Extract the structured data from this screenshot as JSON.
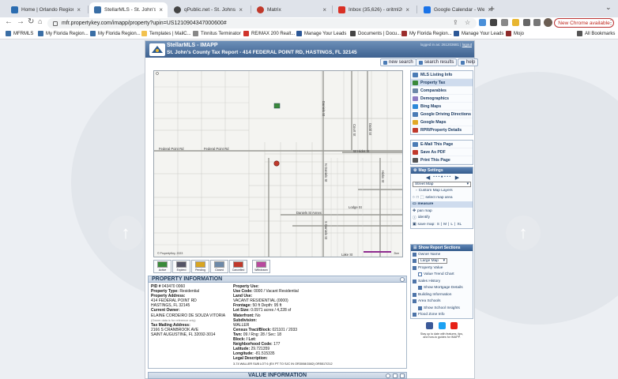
{
  "browser": {
    "tabs": [
      {
        "title": "Home | Orlando Regional REALTOR",
        "color": "#2b6cb0",
        "active": false
      },
      {
        "title": "StellarMLS - St. John's County Ta",
        "color": "#3a6ea5",
        "active": true
      },
      {
        "title": "qPublic.net - St. Johns County, FL",
        "color": "#444444",
        "active": false
      },
      {
        "title": "Matrix",
        "color": "#c0392b",
        "active": false
      },
      {
        "title": "Inbox (35,626) - oritml200@gmail.c",
        "color": "#d93025",
        "active": false
      },
      {
        "title": "Google Calendar - Week of Octob",
        "color": "#1a73e8",
        "active": false
      }
    ],
    "url": "mfr.propertykey.com/imapp/property?upin=US1210904347000600#",
    "update_label": "New Chrome available",
    "bookmarks": [
      {
        "label": "MFRMLS",
        "color": "#3a6ea5"
      },
      {
        "label": "My Florida Region...",
        "color": "#3a6ea5"
      },
      {
        "label": "My Florida Region...",
        "color": "#3a6ea5"
      },
      {
        "label": "Templates | MailC...",
        "color": "#f2c14e"
      },
      {
        "label": "Tinnitus Terminator",
        "color": "#888888"
      },
      {
        "label": "RE/MAX 200 Realt...",
        "color": "#d0342c"
      },
      {
        "label": "Manage Your Leads",
        "color": "#2b5797"
      },
      {
        "label": "Documents | Docu...",
        "color": "#444444"
      },
      {
        "label": "My Florida Region...",
        "color": "#9b2d2d"
      },
      {
        "label": "Manage Your Leads",
        "color": "#2b5797"
      },
      {
        "label": "Mojo",
        "color": "#8e2b2b"
      },
      {
        "label": "All Bookmarks",
        "color": "#555555"
      }
    ]
  },
  "header": {
    "title": "StellarMLS - IMAPP",
    "subtitle": "St. John's County Tax Report - 414 FEDERAL POINT RD, HASTINGS, FL 32145",
    "logged_in": "logged in as: 261203681 |",
    "logout": "logout"
  },
  "top_buttons": {
    "new_search": "new search",
    "search_results": "search results",
    "help": "help"
  },
  "map": {
    "credit": "© PropertyKey, 2023",
    "scale": "2km",
    "roads": {
      "federal_point": "Federal Point Rd",
      "federal_point_2": "Federal Point Rd",
      "w_hicks": "W Hicks St",
      "daniels": "Daniels St",
      "n_daniels": "N Daniels St",
      "s_daniels": "S Daniels St",
      "daniels_st_annex": "Daniels St Annex",
      "lodge": "Lodge St",
      "court": "Court St",
      "dodd": "Dodd St",
      "hicks": "Hicks St",
      "lake": "Lake St"
    }
  },
  "legend": [
    {
      "label": "Active",
      "color": "#3a8a3a"
    },
    {
      "label": "Expired",
      "color": "#555566"
    },
    {
      "label": "Pending",
      "color": "#d9a521"
    },
    {
      "label": "Closed",
      "color": "#6d89a8"
    },
    {
      "label": "Cancelled",
      "color": "#c0392b"
    },
    {
      "label": "Withdrawn",
      "color": "#b84a9e"
    }
  ],
  "property_info": {
    "section_title": "PROPERTY INFORMATION",
    "left": [
      {
        "label": "PID #",
        "value": "043470 0060"
      },
      {
        "label": "Property Type:",
        "value": "Residential"
      },
      {
        "label": "Property Address:",
        "value": ""
      },
      {
        "label": "",
        "value": "414 FEDERAL POINT RD"
      },
      {
        "label": "",
        "value": "HASTINGS, FL 32145"
      },
      {
        "label": "Current Owner:",
        "value": ""
      },
      {
        "label": "",
        "value": "ELAINE CORDEIRO DE SOUZA VITORIA"
      },
      {
        "label": "",
        "value": "(Owner data is for reference only)"
      },
      {
        "label": "Tax Mailing Address:",
        "value": ""
      },
      {
        "label": "",
        "value": "2166 S CRANBROOK AVE"
      },
      {
        "label": "",
        "value": "SAINT AUGUSTINE, FL 32092-3014"
      }
    ],
    "right": [
      {
        "label": "Property Use:",
        "value": ""
      },
      {
        "label": "Use Code:",
        "value": "0000 / Vacant Residential"
      },
      {
        "label": "Land Use:",
        "value": ""
      },
      {
        "label": "",
        "value": "VACANT RESIDENTIAL (0000)"
      },
      {
        "label": "Frontage:",
        "value": "50 ft Depth: 95 ft"
      },
      {
        "label": "Lot Size:",
        "value": "0.0971 acres / 4,228 sf"
      },
      {
        "label": "Waterfront:",
        "value": "No"
      },
      {
        "label": "Subdivision:",
        "value": ""
      },
      {
        "label": "",
        "value": "WALLER"
      },
      {
        "label": "Census Tract/Block:",
        "value": "021101 / 2033"
      },
      {
        "label": "Twn:",
        "value": "09 / Rng: 28 / Sec: 18"
      },
      {
        "label": "Block: / Lot:",
        "value": ""
      },
      {
        "label": "Neighborhood Code:",
        "value": "177"
      },
      {
        "label": "Latitude:",
        "value": "29.721359"
      },
      {
        "label": "Longitude:",
        "value": "-81.515335"
      },
      {
        "label": "Legal Description:",
        "value": ""
      },
      {
        "label": "",
        "value": "3-74 WALLER SUB LOT 6 (EX PT TO SJC IN OR3008/1582) OR5517/212"
      }
    ]
  },
  "value_section_title": "VALUE INFORMATION",
  "sidebar": {
    "nav": [
      {
        "label": "MLS Listing Info",
        "color": "#4a7bb5",
        "selected": false
      },
      {
        "label": "Property Tax",
        "color": "#3a8a3a",
        "selected": true
      },
      {
        "label": "Comparables",
        "color": "#6d89a8",
        "selected": false
      },
      {
        "label": "Demographics",
        "color": "#8e7cc3",
        "selected": false
      },
      {
        "label": "Bing Maps",
        "color": "#2b88d8",
        "selected": false
      },
      {
        "label": "Google Driving Directions",
        "color": "#4a7bb5",
        "selected": false
      },
      {
        "label": "Google Maps",
        "color": "#e1a927",
        "selected": false
      },
      {
        "label": "RPR/Property Details",
        "color": "#c0392b",
        "selected": false
      }
    ],
    "actions": [
      {
        "label": "E-Mail This Page",
        "color": "#4a7bb5"
      },
      {
        "label": "Save As PDF",
        "color": "#c0392b"
      },
      {
        "label": "Print This Page",
        "color": "#555555"
      }
    ],
    "map_settings": {
      "title": "Map Settings",
      "map_type": "Street Map",
      "custom_layers": "Custom Map Layers",
      "select_area": "select map area",
      "measure": "measure",
      "pan": "pan map",
      "identify": "identify",
      "save_map_label": "save map:",
      "sizes": [
        "S",
        "M",
        "L",
        "XL"
      ]
    },
    "report": {
      "title": "Show Report Sections",
      "items": [
        {
          "label": "Owner Name",
          "checked": true,
          "indent": 0
        },
        {
          "label": "",
          "checked": true,
          "indent": 0,
          "dropdown": "Large Map"
        },
        {
          "label": "Property Value",
          "checked": true,
          "indent": 0
        },
        {
          "label": "Value Trend Chart",
          "checked": false,
          "indent": 1
        },
        {
          "label": "Sales History",
          "checked": true,
          "indent": 0
        },
        {
          "label": "Show Mortgage Details",
          "checked": true,
          "indent": 1
        },
        {
          "label": "Building Information",
          "checked": true,
          "indent": 0
        },
        {
          "label": "Area Schools",
          "checked": true,
          "indent": 0
        },
        {
          "label": "Show School Insights",
          "checked": true,
          "indent": 1
        },
        {
          "label": "Flood Zone Info",
          "checked": true,
          "indent": 0
        }
      ]
    },
    "social_text_1": "Stay up to date with features, tips,",
    "social_text_2": "and how-to guides for IMAPP."
  }
}
